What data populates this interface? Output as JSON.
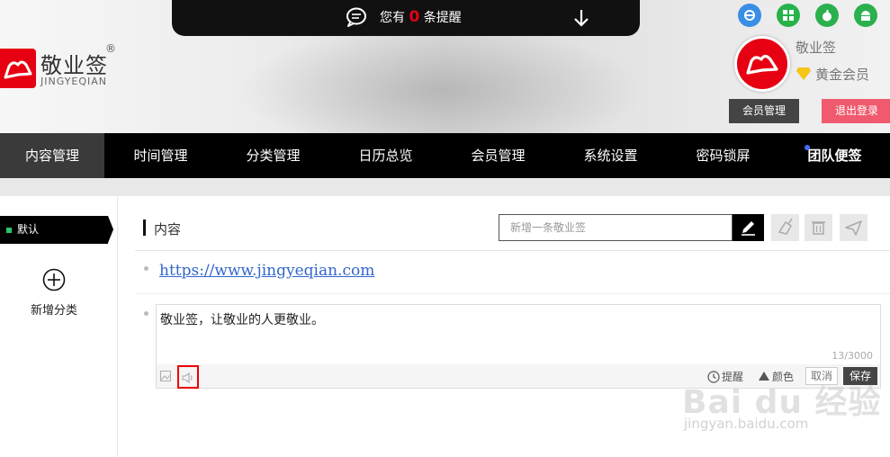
{
  "notice": {
    "prefix": "您有",
    "count": "0",
    "suffix": "条提醒"
  },
  "logo": {
    "name": "敬业签",
    "reg": "®",
    "pinyin": "JINGYEQIAN"
  },
  "platforms": [
    "ie-icon",
    "windows-icon",
    "apple-icon",
    "android-icon"
  ],
  "user": {
    "name": "敬业签",
    "level": "黄金会员",
    "member_btn": "会员管理",
    "logout_btn": "退出登录"
  },
  "nav": {
    "items": [
      "内容管理",
      "时间管理",
      "分类管理",
      "日历总览",
      "会员管理",
      "系统设置",
      "密码锁屏",
      "团队便签"
    ],
    "active": "内容管理"
  },
  "sidebar": {
    "default_category": "默认",
    "add_category": "新增分类"
  },
  "main": {
    "section_title": "内容",
    "new_note_placeholder": "新增一条敬业签",
    "notes": [
      {
        "text": "https://www.jingyeqian.com"
      }
    ],
    "editor": {
      "text": "敬业签，让敬业的人更敬业。",
      "count": "13/3000",
      "remind": "提醒",
      "color": "颜色",
      "cancel": "取消",
      "save": "保存"
    }
  },
  "watermark": {
    "logo": "Bai du 经验",
    "url": "jingyan.baidu.com"
  },
  "colors": {
    "brand_red": "#e60012",
    "nav_bg": "#000000",
    "logout": "#f05a6e",
    "link": "#3366cc"
  }
}
